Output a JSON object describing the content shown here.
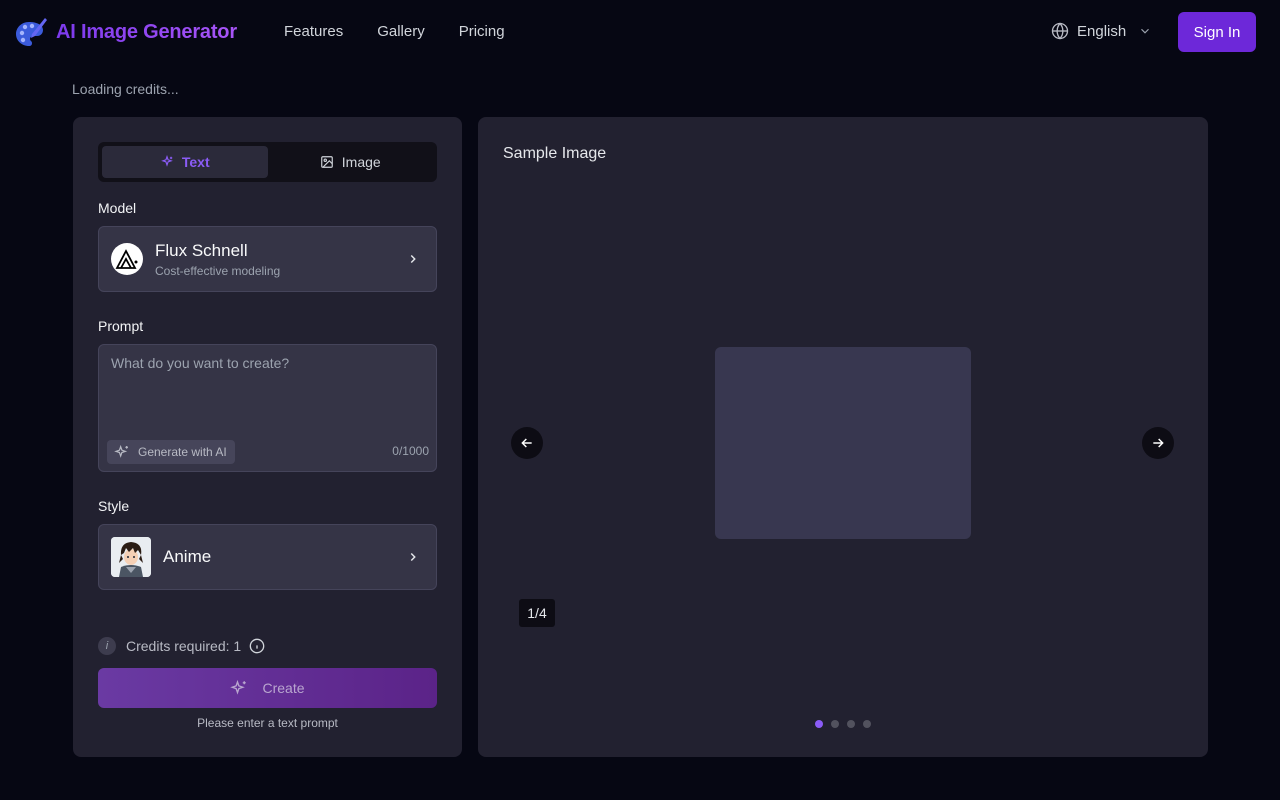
{
  "header": {
    "brand": "AI Image Generator",
    "nav": [
      "Features",
      "Gallery",
      "Pricing"
    ],
    "language": "English",
    "sign_in": "Sign In"
  },
  "status": {
    "credits_loading": "Loading credits..."
  },
  "generator": {
    "tabs": [
      {
        "label": "Text",
        "icon": "sparkles-icon",
        "active": true
      },
      {
        "label": "Image",
        "icon": "image-icon",
        "active": false
      }
    ],
    "model_label": "Model",
    "model": {
      "name": "Flux Schnell",
      "description": "Cost-effective modeling"
    },
    "prompt_label": "Prompt",
    "prompt_placeholder": "What do you want to create?",
    "generate_with_ai": "Generate with AI",
    "char_count": "0/1000",
    "style_label": "Style",
    "style": {
      "name": "Anime"
    },
    "credits_required": "Credits required: 1",
    "create": "Create",
    "hint": "Please enter a text prompt"
  },
  "sample": {
    "title": "Sample Image",
    "counter": "1/4",
    "total": 4,
    "current": 1
  },
  "colors": {
    "accent": "#6d28d9",
    "accent_light": "#8b5cf6",
    "background": "#060713",
    "panel": "#222130"
  }
}
